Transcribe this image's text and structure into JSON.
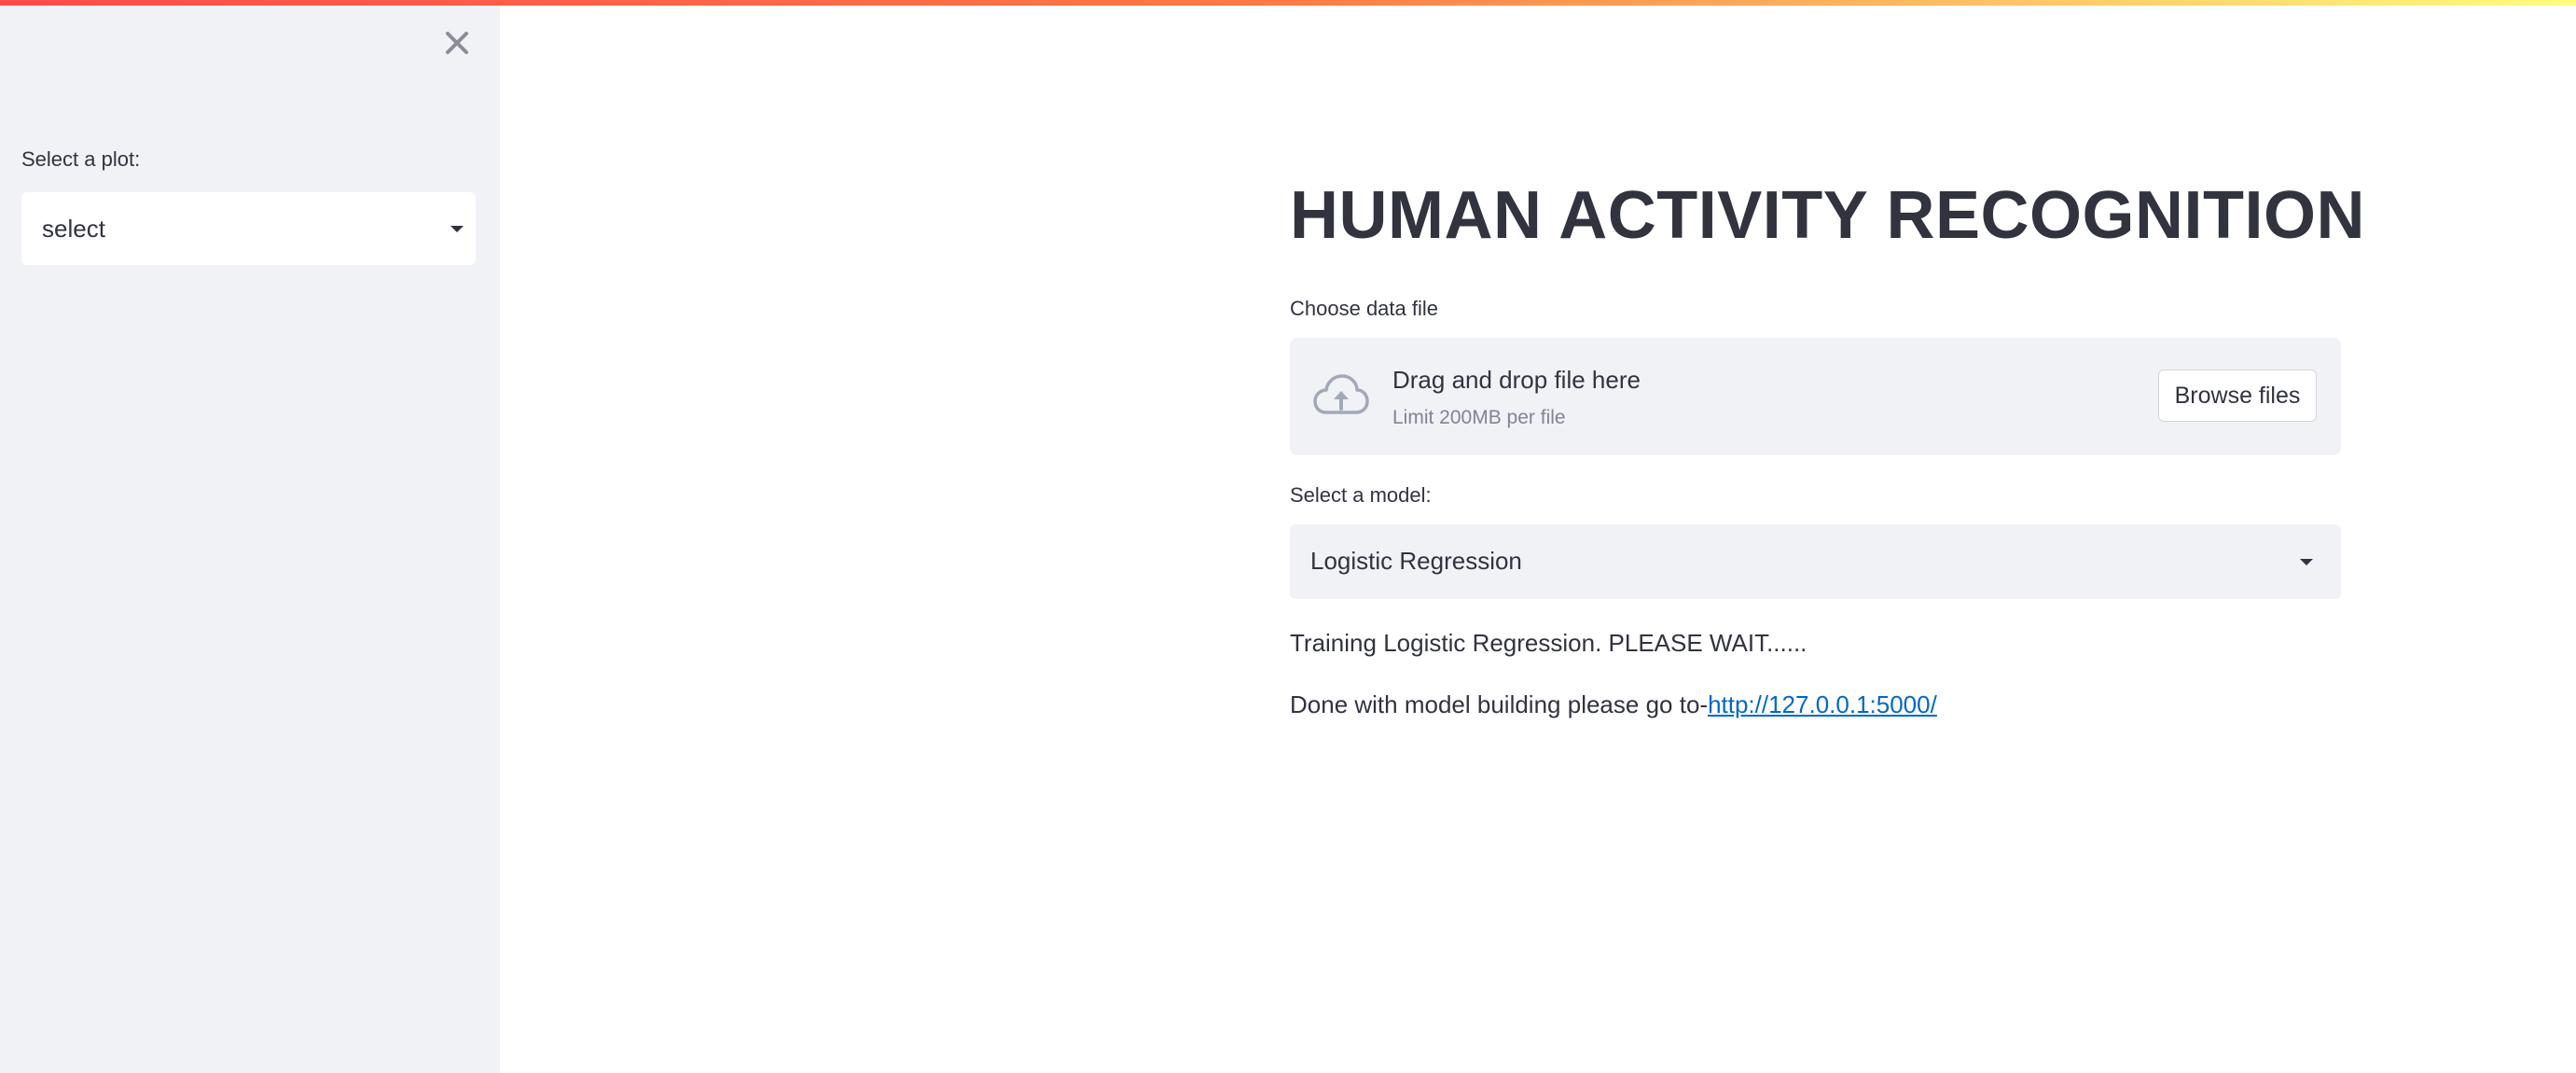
{
  "sidebar": {
    "close_icon": "close-icon",
    "plot_label": "Select a plot:",
    "plot_select_value": "select"
  },
  "main": {
    "title": "HUMAN ACTIVITY RECOGNITION",
    "file_label": "Choose data file",
    "uploader": {
      "icon": "cloud-upload-icon",
      "main_text": "Drag and drop file here",
      "sub_text": "Limit 200MB per file",
      "browse_label": "Browse files"
    },
    "model_label": "Select a model:",
    "model_select_value": "Logistic Regression",
    "training_message": "Training Logistic Regression. PLEASE WAIT......",
    "done_message": "Done with model building please go to-",
    "done_link": "http://127.0.0.1:5000/"
  },
  "colors": {
    "accent_gradient": [
      "#ff4b4b",
      "#ff7a45",
      "#fffd80"
    ],
    "sidebar_bg": "#f0f2f6",
    "text": "#31333f",
    "link": "#0068c9"
  }
}
